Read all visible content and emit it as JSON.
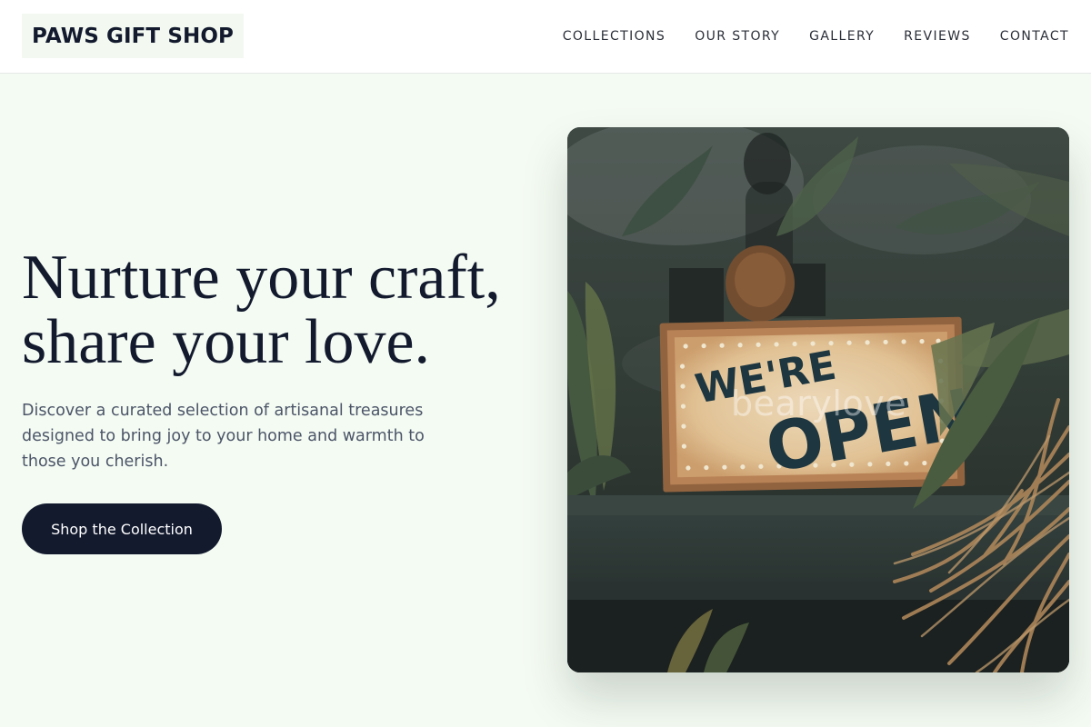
{
  "header": {
    "logo": "PAWS GIFT SHOP",
    "nav": [
      {
        "label": "COLLECTIONS"
      },
      {
        "label": "OUR STORY"
      },
      {
        "label": "GALLERY"
      },
      {
        "label": "REVIEWS"
      },
      {
        "label": "CONTACT"
      }
    ]
  },
  "hero": {
    "headline_line1": "Nurture your craft,",
    "headline_line2": "share your love.",
    "subtext": "Discover a curated selection of artisanal treasures designed to bring joy to your home and warmth to those you cherish.",
    "cta_label": "Shop the Collection",
    "image": {
      "sign_line1": "WE'RE",
      "sign_line2": "OPEN",
      "watermark": "bearylove"
    }
  },
  "colors": {
    "background": "#f4fbf3",
    "header_bg": "#ffffff",
    "logo_bg": "#f3f9f1",
    "text_dark": "#131a2e",
    "text_muted": "#4c5568",
    "cta_bg": "#131a2e",
    "cta_text": "#ffffff"
  }
}
